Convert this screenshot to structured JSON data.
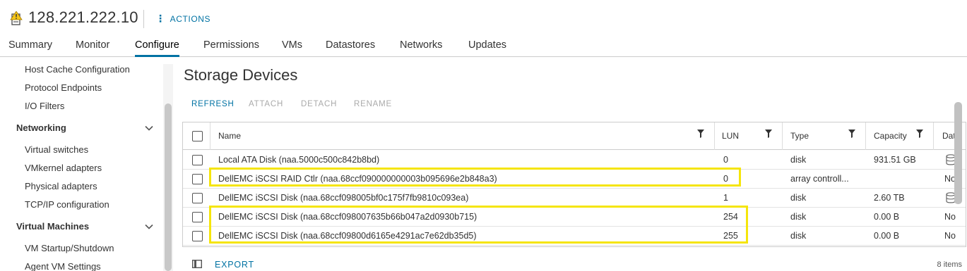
{
  "header": {
    "host_title": "128.221.222.10",
    "actions_label": "ACTIONS",
    "host_icon": "host-warning-icon"
  },
  "tabs": [
    {
      "label": "Summary"
    },
    {
      "label": "Monitor"
    },
    {
      "label": "Configure",
      "active": true
    },
    {
      "label": "Permissions"
    },
    {
      "label": "VMs"
    },
    {
      "label": "Datastores"
    },
    {
      "label": "Networks"
    },
    {
      "label": "Updates"
    }
  ],
  "sidebar": {
    "items_top": [
      "Host Cache Configuration",
      "Protocol Endpoints",
      "I/O Filters"
    ],
    "groups": [
      {
        "label": "Networking",
        "items": [
          "Virtual switches",
          "VMkernel adapters",
          "Physical adapters",
          "TCP/IP configuration"
        ]
      },
      {
        "label": "Virtual Machines",
        "items": [
          "VM Startup/Shutdown",
          "Agent VM Settings"
        ]
      }
    ]
  },
  "main": {
    "title": "Storage Devices",
    "toolbar": {
      "refresh": "REFRESH",
      "attach": "ATTACH",
      "detach": "DETACH",
      "rename": "RENAME"
    },
    "columns": {
      "name": "Name",
      "lun": "LUN",
      "type": "Type",
      "capacity": "Capacity",
      "datastore": "Dat"
    },
    "rows": [
      {
        "name": "Local ATA Disk (naa.5000c500c842b8bd)",
        "lun": "0",
        "type": "disk",
        "capacity": "931.51 GB",
        "datastore": "",
        "ds_icon": true
      },
      {
        "name": "DellEMC iSCSI RAID Ctlr (naa.68ccf090000000003b095696e2b848a3)",
        "lun": "0",
        "type": "array controll...",
        "capacity": "",
        "datastore": "No",
        "ds_icon": false
      },
      {
        "name": "DellEMC iSCSI Disk (naa.68ccf098005bf0c175f7fb9810c093ea)",
        "lun": "1",
        "type": "disk",
        "capacity": "2.60 TB",
        "datastore": "",
        "ds_icon": true
      },
      {
        "name": "DellEMC iSCSI Disk (naa.68ccf098007635b66b047a2d0930b715)",
        "lun": "254",
        "type": "disk",
        "capacity": "0.00 B",
        "datastore": "No",
        "ds_icon": false
      },
      {
        "name": "DellEMC iSCSI Disk (naa.68ccf09800d6165e4291ac7e62db35d5)",
        "lun": "255",
        "type": "disk",
        "capacity": "0.00 B",
        "datastore": "No",
        "ds_icon": false
      }
    ],
    "footer": {
      "export": "EXPORT",
      "count": "8 items"
    }
  },
  "colors": {
    "accent": "#0072a3",
    "highlight": "#f5e50a",
    "warning": "#f5a623"
  }
}
